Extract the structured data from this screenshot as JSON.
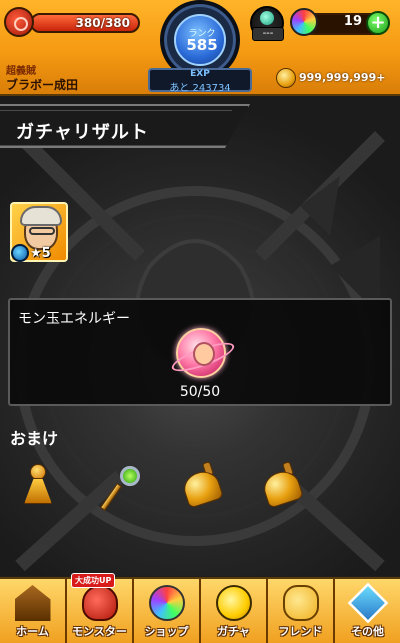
{
  "header": {
    "hp": {
      "current_max_text": "380/380",
      "fraction": 1.0
    },
    "rank": {
      "label": "ランク",
      "value": "585"
    },
    "exp": {
      "label": "EXP",
      "remaining_text": "あと 243734"
    },
    "stamina": {
      "box_text": "---"
    },
    "gems": {
      "count": "19",
      "plus_label": "+"
    },
    "player": {
      "title": "超義賊",
      "name": "ブラボー成田"
    },
    "coins": {
      "value": "999,999,999+"
    }
  },
  "page": {
    "title": "ガチャリザルト"
  },
  "result": {
    "monster": {
      "star_label": "★5"
    },
    "energy": {
      "title": "モン玉エネルギー",
      "value": "50/50"
    },
    "bonus": {
      "label": "おまけ"
    }
  },
  "nav": {
    "items": [
      {
        "id": "home",
        "label": "ホーム",
        "icon": "home-icon"
      },
      {
        "id": "monster",
        "label": "モンスター",
        "icon": "monster-icon",
        "badge": "大成功UP"
      },
      {
        "id": "shop",
        "label": "ショップ",
        "icon": "orb-icon"
      },
      {
        "id": "gacha",
        "label": "ガチャ",
        "icon": "gacha-icon"
      },
      {
        "id": "friend",
        "label": "フレンド",
        "icon": "friend-icon"
      },
      {
        "id": "other",
        "label": "その他",
        "icon": "other-icon"
      }
    ]
  },
  "colors": {
    "header_orange": "#f59a12",
    "nav_orange": "#ffb429",
    "exp_blue": "#7cc2ff",
    "plus_green": "#1c9c1a"
  }
}
